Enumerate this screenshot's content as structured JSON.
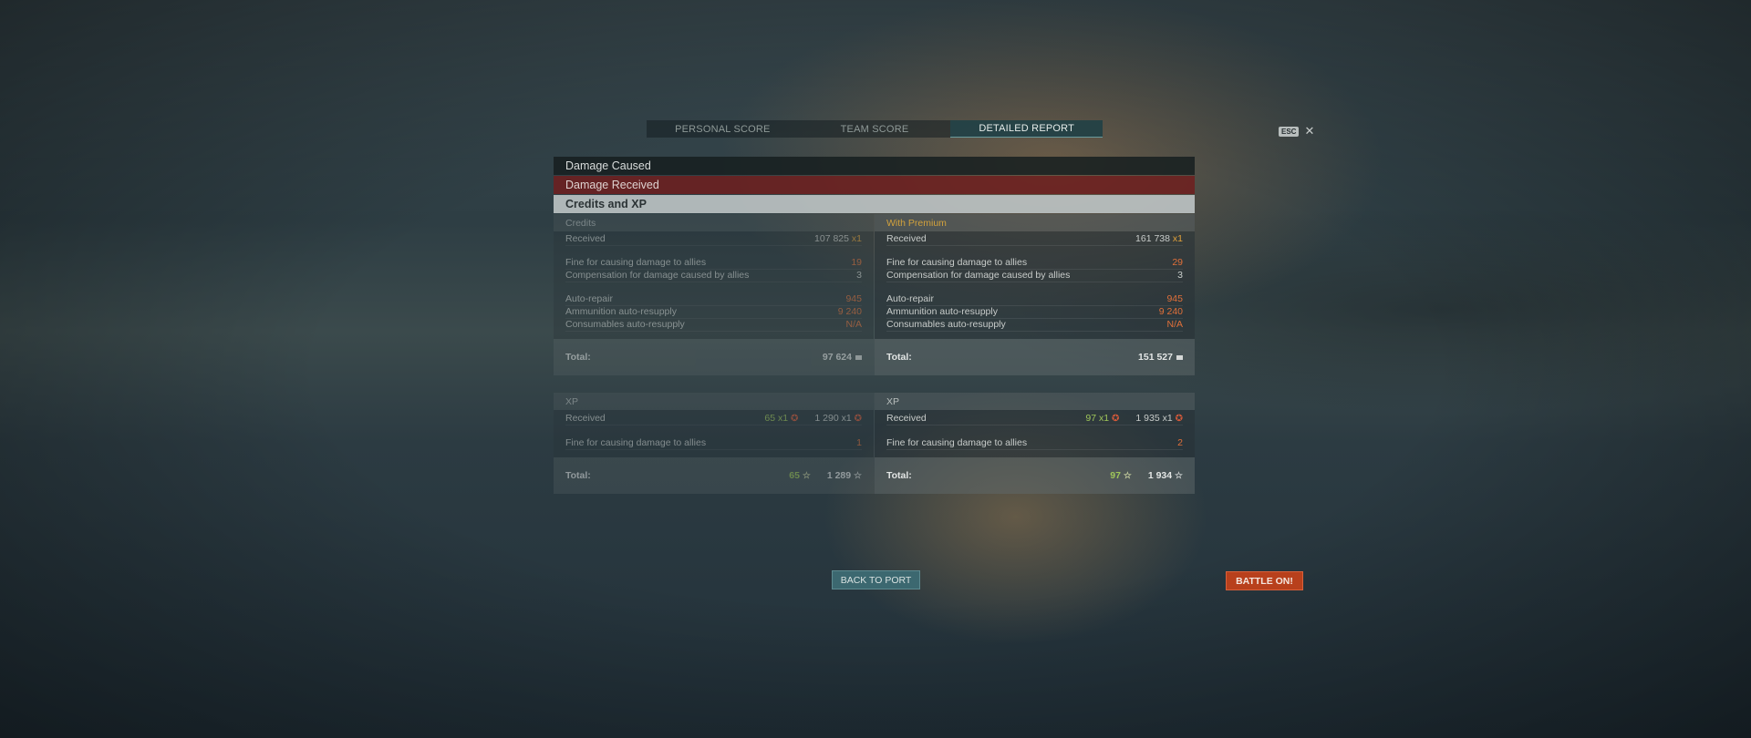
{
  "tabs": [
    {
      "label": "PERSONAL SCORE",
      "active": false
    },
    {
      "label": "TEAM SCORE",
      "active": false
    },
    {
      "label": "DETAILED REPORT",
      "active": true
    }
  ],
  "esc_label": "ESC",
  "close_glyph": "✕",
  "sections": {
    "damage_caused": "Damage Caused",
    "damage_received": "Damage Received",
    "credits_xp": "Credits and XP"
  },
  "credits": {
    "left": {
      "title": "Credits",
      "received_label": "Received",
      "received_value": "107 825",
      "received_mult": "x1",
      "fine_label": "Fine for causing damage to allies",
      "fine_value": "19",
      "comp_label": "Compensation for damage caused by allies",
      "comp_value": "3",
      "repair_label": "Auto-repair",
      "repair_value": "945",
      "ammo_label": "Ammunition auto-resupply",
      "ammo_value": "9 240",
      "cons_label": "Consumables auto-resupply",
      "cons_value": "N/A",
      "total_label": "Total:",
      "total_value": "97 624"
    },
    "right": {
      "title": "With Premium",
      "received_label": "Received",
      "received_value": "161 738",
      "received_mult": "x1",
      "fine_label": "Fine for causing damage to allies",
      "fine_value": "29",
      "comp_label": "Compensation for damage caused by allies",
      "comp_value": "3",
      "repair_label": "Auto-repair",
      "repair_value": "945",
      "ammo_label": "Ammunition auto-resupply",
      "ammo_value": "9 240",
      "cons_label": "Consumables auto-resupply",
      "cons_value": "N/A",
      "total_label": "Total:",
      "total_value": "151 527"
    }
  },
  "xp": {
    "left": {
      "title": "XP",
      "received_label": "Received",
      "received_free": "65 x1",
      "received_xp": "1 290 x1",
      "fine_label": "Fine for causing damage to allies",
      "fine_value": "1",
      "total_label": "Total:",
      "total_free": "65",
      "total_xp": "1 289"
    },
    "right": {
      "title": "XP",
      "received_label": "Received",
      "received_free": "97 x1",
      "received_xp": "1 935 x1",
      "fine_label": "Fine for causing damage to allies",
      "fine_value": "2",
      "total_label": "Total:",
      "total_free": "97",
      "total_xp": "1 934"
    }
  },
  "buttons": {
    "back": "BACK TO PORT",
    "battle": "BATTLE ON!"
  },
  "colors": {
    "accent_teal": "#3c6870",
    "battle_orange": "#b8401c",
    "premium_gold": "#d2a23d",
    "fine_orange": "#e0703a",
    "xp_green": "#9fc65a"
  }
}
